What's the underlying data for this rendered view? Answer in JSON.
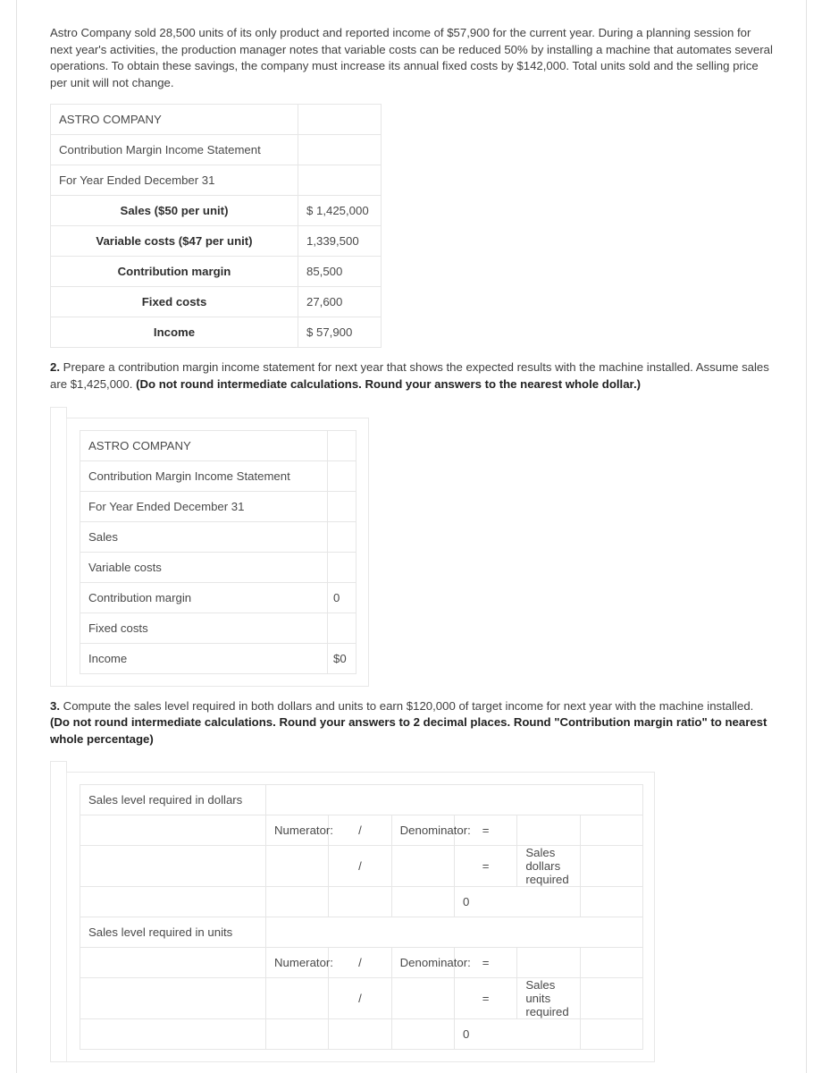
{
  "problem": {
    "intro": "Astro Company sold 28,500 units of its only product and reported income of $57,900 for the current year. During a planning session for next year's activities, the production manager notes that variable costs can be reduced 50% by installing a machine that automates several operations. To obtain these savings, the company must increase its annual fixed costs by $142,000. Total units sold and the selling price per unit will not change."
  },
  "given_statement": {
    "company": "ASTRO COMPANY",
    "statement_title": "Contribution Margin Income Statement",
    "period": "For Year Ended December 31",
    "rows": [
      {
        "label": "Sales ($50 per unit)",
        "value": "$ 1,425,000"
      },
      {
        "label": "Variable costs ($47 per unit)",
        "value": "1,339,500"
      },
      {
        "label": "Contribution margin",
        "value": "85,500"
      },
      {
        "label": "Fixed costs",
        "value": "27,600"
      },
      {
        "label": "Income",
        "value": "$ 57,900"
      }
    ]
  },
  "question2": {
    "number": "2.",
    "text_a": " Prepare a contribution margin income statement for next year that shows the expected results with the machine installed. Assume sales are $1,425,000. ",
    "text_b": "(Do not round intermediate calculations. Round your answers to the nearest whole dollar.)"
  },
  "answer_statement": {
    "company": "ASTRO COMPANY",
    "statement_title": "Contribution Margin Income Statement",
    "period": "For Year Ended December 31",
    "rows": [
      {
        "label": "Sales",
        "value": ""
      },
      {
        "label": "Variable costs",
        "value": ""
      },
      {
        "label": "Contribution margin",
        "value": "0"
      },
      {
        "label": "Fixed costs",
        "value": ""
      },
      {
        "label": "Income",
        "value": "$0"
      }
    ]
  },
  "question3": {
    "number": "3.",
    "text_a": " Compute the sales level required in both dollars and units to earn $120,000 of target income for next year with the machine installed. ",
    "text_b": "(Do not round intermediate calculations. Round your answers to 2 decimal places. Round \"Contribution margin ratio\" to nearest whole percentage)"
  },
  "sales_level": {
    "labels": {
      "numerator": "Numerator:",
      "denominator": "Denominator:",
      "slash": "/",
      "equals": "="
    },
    "sections": [
      {
        "heading": "Sales level required in dollars",
        "result_label": "Sales dollars required",
        "total": "0"
      },
      {
        "heading": "Sales level required in units",
        "result_label": "Sales units required",
        "total": "0"
      }
    ]
  }
}
